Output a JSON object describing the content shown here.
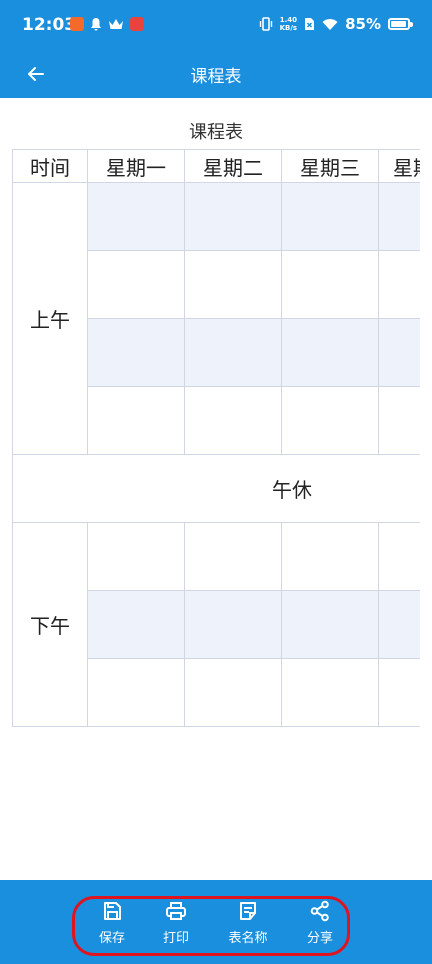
{
  "status": {
    "time": "12:03",
    "net_top": "1.40",
    "net_bottom": "KB/s",
    "battery": "85%"
  },
  "appbar": {
    "title": "课程表"
  },
  "table": {
    "title": "课程表",
    "headers": [
      "时间",
      "星期一",
      "星期二",
      "星期三",
      "星期"
    ],
    "morning_label": "上午",
    "noon_label": "午休",
    "afternoon_label": "下午"
  },
  "actions": [
    {
      "label": "保存",
      "icon": "save-icon"
    },
    {
      "label": "打印",
      "icon": "printer-icon"
    },
    {
      "label": "表名称",
      "icon": "note-icon"
    },
    {
      "label": "分享",
      "icon": "share-icon"
    }
  ],
  "colors": {
    "primary": "#1a8fde",
    "row_shade": "#eef2fb",
    "highlight": "#e0141e"
  }
}
